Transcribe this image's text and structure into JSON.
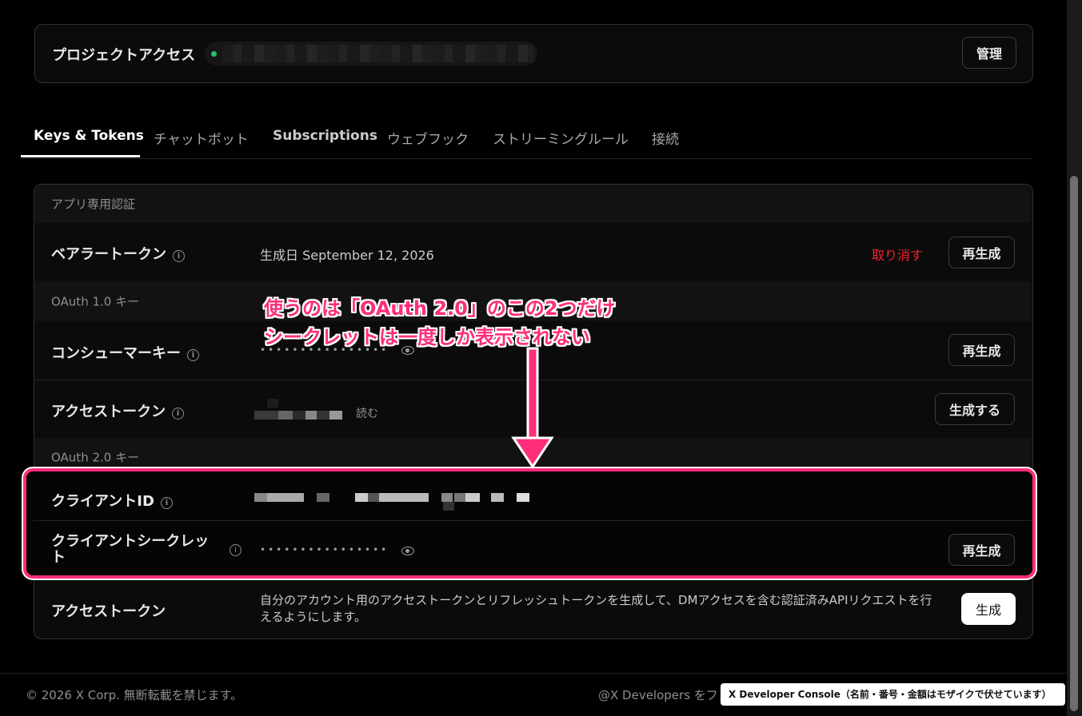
{
  "project": {
    "title": "プロジェクトアクセス",
    "manage_button": "管理",
    "status_color": "#25c26b"
  },
  "tabs": [
    "Keys & Tokens",
    "チャットボット",
    "Subscriptions",
    "ウェブフック",
    "ストリーミングルール",
    "接続"
  ],
  "sections": {
    "app_auth": "アプリ専用認証",
    "oauth1": "OAuth 1.0 キー",
    "oauth2": "OAuth 2.0 キー"
  },
  "bearer": {
    "label": "ベアラートークン",
    "created": "生成日 September 12, 2026",
    "revoke": "取り消す",
    "regenerate": "再生成"
  },
  "consumer": {
    "label": "コンシューマーキー",
    "masked": "••••••••••••••••",
    "regenerate": "再生成"
  },
  "access1": {
    "label": "アクセストークン",
    "permission": "読む",
    "generate": "生成する"
  },
  "client_id": {
    "label": "クライアントID"
  },
  "client_secret": {
    "label": "クライアントシークレット",
    "masked": "••••••••••••••••",
    "regenerate": "再生成"
  },
  "access2": {
    "label": "アクセストークン",
    "description": "自分のアカウント用のアクセストークンとリフレッシュトークンを生成して、DMアクセスを含む認証済みAPIリクエストを行えるようにします。",
    "generate": "生成"
  },
  "annotation": {
    "line1": "使うのは「OAuth 2.0」のこの2つだけ",
    "line2": "シークレットは一度しか表示されない",
    "color": "#ff2e7a"
  },
  "footer": {
    "copyright": "© 2026 X Corp. 無断転載を禁じます。",
    "follow": "@X Developers をフォ",
    "caption": "X Developer Console（名前・番号・金額はモザイクで伏せています）"
  }
}
